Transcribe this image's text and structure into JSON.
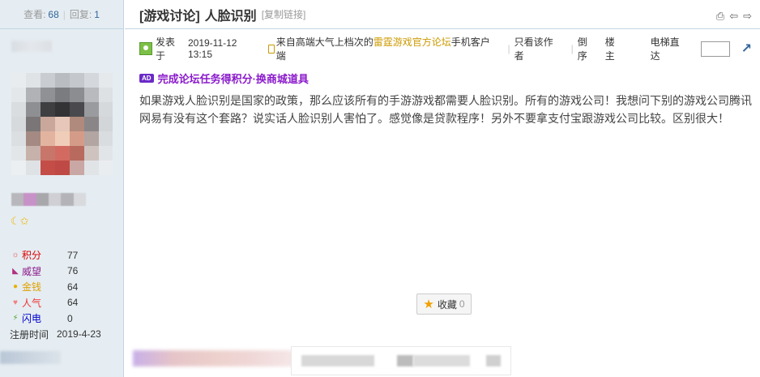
{
  "sidebar": {
    "stats": {
      "views_label": "查看:",
      "views": "68",
      "replies_label": "回复:",
      "replies": "1"
    },
    "attributes": [
      {
        "icon": "sun-icon",
        "label": "积分",
        "value": "77",
        "color": "#dd0000"
      },
      {
        "icon": "prestige-icon",
        "label": "威望",
        "value": "76",
        "color": "#8b1a8b"
      },
      {
        "icon": "coin-icon",
        "label": "金钱",
        "value": "64",
        "color": "#e0a000"
      },
      {
        "icon": "heart-icon",
        "label": "人气",
        "value": "64",
        "color": "#ee3333"
      },
      {
        "icon": "lightning-icon",
        "label": "闪电",
        "value": "0",
        "color": "#0000cc"
      },
      {
        "icon": "",
        "label": "注册时间",
        "value": "2019-4-23",
        "color": "#333333"
      }
    ]
  },
  "thread": {
    "category": "[游戏讨论]",
    "title": "人脸识别",
    "copy_link": "[复制链接]"
  },
  "post": {
    "posted_prefix": "发表于",
    "timestamp": "2019-11-12 13:15",
    "source_prefix": "来自高端大气上档次的",
    "source_brand": "雷霆游戏官方论坛",
    "source_suffix": "手机客户端",
    "only_author": "只看该作者",
    "reverse": "倒序",
    "floor": "楼主",
    "elevator": "电梯直达",
    "task_badge": "AD",
    "task_text": "完成论坛任务得积分·换商城道具",
    "content": "如果游戏人脸识别是国家的政策，那么应该所有的手游游戏都需要人脸识别。所有的游戏公司！我想问下别的游戏公司腾讯网易有没有这个套路？说实话人脸识别人害怕了。感觉像是贷款程序！另外不要拿支付宝跟游戏公司比较。区别很大！",
    "favorite_label": "收藏",
    "favorite_count": "0"
  }
}
